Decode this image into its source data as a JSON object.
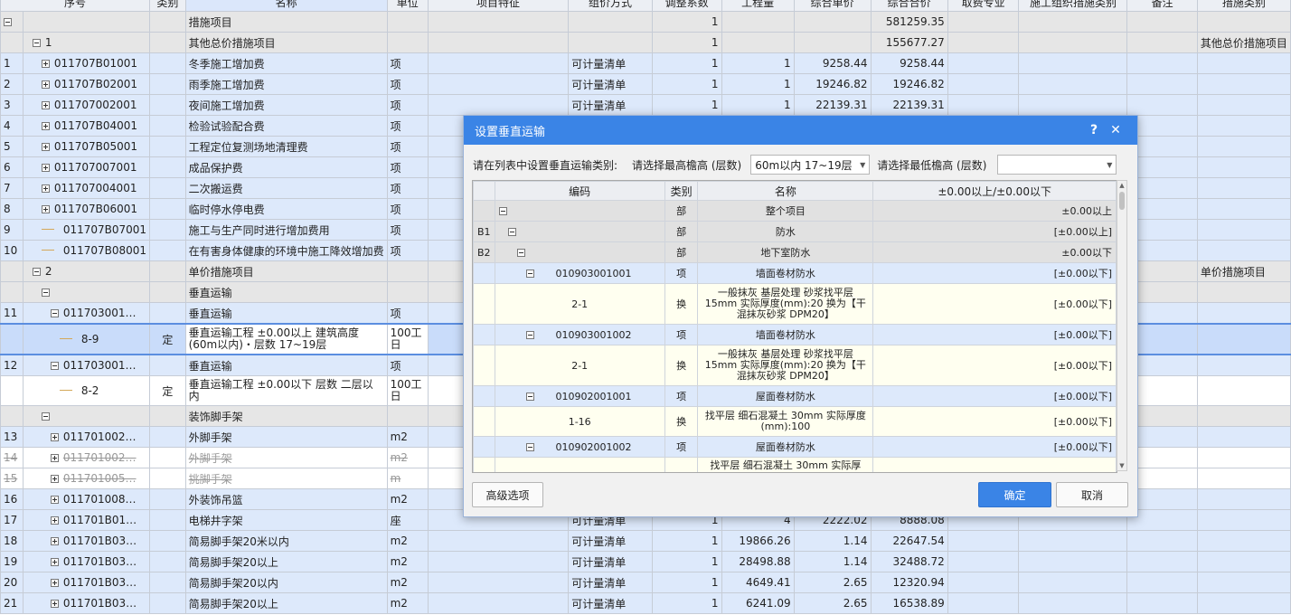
{
  "grid": {
    "headers": [
      "序号",
      "类别",
      "名称",
      "单位",
      "项目特征",
      "组价方式",
      "调整系数",
      "工程量",
      "综合单价",
      "综合合价",
      "取费专业",
      "施工组织措施类别",
      "备注",
      "措施类别"
    ],
    "rows": [
      {
        "seq": "",
        "code": "",
        "type": "",
        "name": "措施项目",
        "unit": "",
        "feature": "",
        "method": "",
        "coef": "1",
        "qty": "",
        "price": "",
        "total": "581259.35",
        "fee": "",
        "org": "",
        "note": "",
        "cat": ""
      },
      {
        "seq": "",
        "code": "1",
        "type": "",
        "name": "其他总价措施项目",
        "unit": "",
        "feature": "",
        "method": "",
        "coef": "1",
        "qty": "",
        "price": "",
        "total": "155677.27",
        "fee": "",
        "org": "",
        "note": "",
        "cat": "其他总价措施项目"
      },
      {
        "seq": "1",
        "code": "011707B01001",
        "type": "",
        "name": "冬季施工增加费",
        "unit": "项",
        "feature": "",
        "method": "可计量清单",
        "coef": "1",
        "qty": "1",
        "price": "9258.44",
        "total": "9258.44"
      },
      {
        "seq": "2",
        "code": "011707B02001",
        "type": "",
        "name": "雨季施工增加费",
        "unit": "项",
        "feature": "",
        "method": "可计量清单",
        "coef": "1",
        "qty": "1",
        "price": "19246.82",
        "total": "19246.82"
      },
      {
        "seq": "3",
        "code": "011707002001",
        "type": "",
        "name": "夜间施工增加费",
        "unit": "项",
        "feature": "",
        "method": "可计量清单",
        "coef": "1",
        "qty": "1",
        "price": "22139.31",
        "total": "22139.31"
      },
      {
        "seq": "4",
        "code": "011707B04001",
        "type": "",
        "name": "检验试验配合费",
        "unit": "项"
      },
      {
        "seq": "5",
        "code": "011707B05001",
        "type": "",
        "name": "工程定位复测场地清理费",
        "unit": "项"
      },
      {
        "seq": "6",
        "code": "011707007001",
        "type": "",
        "name": "成品保护费",
        "unit": "项"
      },
      {
        "seq": "7",
        "code": "011707004001",
        "type": "",
        "name": "二次搬运费",
        "unit": "项"
      },
      {
        "seq": "8",
        "code": "011707B06001",
        "type": "",
        "name": "临时停水停电费",
        "unit": "项"
      },
      {
        "seq": "9",
        "code": "011707B07001",
        "type": "",
        "name": "施工与生产同时进行增加费用",
        "unit": "项"
      },
      {
        "seq": "10",
        "code": "011707B08001",
        "type": "",
        "name": "在有害身体健康的环境中施工降效增加费",
        "unit": "项"
      },
      {
        "seq": "",
        "code": "2",
        "type": "",
        "name": "单价措施项目",
        "unit": "",
        "cat": "单价措施项目"
      },
      {
        "seq": "",
        "code": "",
        "type": "",
        "name": "垂直运输",
        "unit": ""
      },
      {
        "seq": "11",
        "code": "011703001…",
        "type": "",
        "name": "垂直运输",
        "unit": "项"
      },
      {
        "seq": "",
        "code": "8-9",
        "type": "定",
        "name": "垂直运输工程 ±0.00以上 建筑高度(60m以内)・层数 17~19层",
        "unit": "100工日"
      },
      {
        "seq": "12",
        "code": "011703001…",
        "type": "",
        "name": "垂直运输",
        "unit": "项"
      },
      {
        "seq": "",
        "code": "8-2",
        "type": "定",
        "name": "垂直运输工程 ±0.00以下 层数 二层以内",
        "unit": "100工日"
      },
      {
        "seq": "",
        "code": "",
        "type": "",
        "name": "装饰脚手架",
        "unit": ""
      },
      {
        "seq": "13",
        "code": "011701002…",
        "type": "",
        "name": "外脚手架",
        "unit": "m2"
      },
      {
        "seq": "14",
        "code": "011701002…",
        "type": "",
        "name": "外脚手架",
        "unit": "m2"
      },
      {
        "seq": "15",
        "code": "011701005…",
        "type": "",
        "name": "挑脚手架",
        "unit": "m"
      },
      {
        "seq": "16",
        "code": "011701008…",
        "type": "",
        "name": "外装饰吊篮",
        "unit": "m2"
      },
      {
        "seq": "17",
        "code": "011701B01…",
        "type": "",
        "name": "电梯井字架",
        "unit": "座",
        "method": "可计量清单",
        "coef": "1",
        "qty": "4",
        "price": "2222.02",
        "total": "8888.08"
      },
      {
        "seq": "18",
        "code": "011701B03…",
        "type": "",
        "name": "简易脚手架20米以内",
        "unit": "m2",
        "method": "可计量清单",
        "coef": "1",
        "qty": "19866.26",
        "price": "1.14",
        "total": "22647.54"
      },
      {
        "seq": "19",
        "code": "011701B03…",
        "type": "",
        "name": "简易脚手架20以上",
        "unit": "m2",
        "method": "可计量清单",
        "coef": "1",
        "qty": "28498.88",
        "price": "1.14",
        "total": "32488.72"
      },
      {
        "seq": "20",
        "code": "011701B03…",
        "type": "",
        "name": "简易脚手架20以内",
        "unit": "m2",
        "method": "可计量清单",
        "coef": "1",
        "qty": "4649.41",
        "price": "2.65",
        "total": "12320.94"
      },
      {
        "seq": "21",
        "code": "011701B03…",
        "type": "",
        "name": "简易脚手架20以上",
        "unit": "m2",
        "method": "可计量清单",
        "coef": "1",
        "qty": "6241.09",
        "price": "2.65",
        "total": "16538.89"
      }
    ]
  },
  "dialog": {
    "title": "设置垂直运输",
    "help": "?",
    "close": "✕",
    "filter_label": "请在列表中设置垂直运输类别:",
    "max_label": "请选择最高檐高 (层数)",
    "max_value": "60m以内 17~19层",
    "min_label": "请选择最低檐高 (层数)",
    "min_value": "",
    "headers": [
      "编码",
      "类别",
      "名称",
      "±0.00以上/±0.00以下"
    ],
    "rows": [
      {
        "rowhdr": "",
        "code": "",
        "type": "部",
        "name": "整个项目",
        "val": "±0.00以上"
      },
      {
        "rowhdr": "B1",
        "code": "",
        "type": "部",
        "name": "防水",
        "val": "[±0.00以上]"
      },
      {
        "rowhdr": "B2",
        "code": "",
        "type": "部",
        "name": "地下室防水",
        "val": "±0.00以下"
      },
      {
        "rowhdr": "",
        "code": "010903001001",
        "type": "项",
        "name": "墙面卷材防水",
        "val": "[±0.00以下]"
      },
      {
        "rowhdr": "",
        "code": "2-1",
        "type": "换",
        "name": "一般抹灰 基层处理 砂浆找平层15mm 实际厚度(mm):20 换为【干混抹灰砂浆 DPM20】",
        "val": "[±0.00以下]"
      },
      {
        "rowhdr": "",
        "code": "010903001002",
        "type": "项",
        "name": "墙面卷材防水",
        "val": "[±0.00以下]"
      },
      {
        "rowhdr": "",
        "code": "2-1",
        "type": "换",
        "name": "一般抹灰 基层处理 砂浆找平层15mm 实际厚度(mm):20 换为【干混抹灰砂浆 DPM20】",
        "val": "[±0.00以下]"
      },
      {
        "rowhdr": "",
        "code": "010902001001",
        "type": "项",
        "name": "屋面卷材防水",
        "val": "[±0.00以下]"
      },
      {
        "rowhdr": "",
        "code": "1-16",
        "type": "换",
        "name": "找平层 细石混凝土 30mm 实际厚度(mm):100",
        "val": "[±0.00以下]"
      },
      {
        "rowhdr": "",
        "code": "010902001002",
        "type": "项",
        "name": "屋面卷材防水",
        "val": "[±0.00以下]"
      },
      {
        "rowhdr": "",
        "code": "",
        "type": "",
        "name": "找平层 细石混凝土 30mm 实际厚",
        "val": ""
      }
    ],
    "advanced": "高级选项",
    "ok": "确定",
    "cancel": "取消"
  }
}
